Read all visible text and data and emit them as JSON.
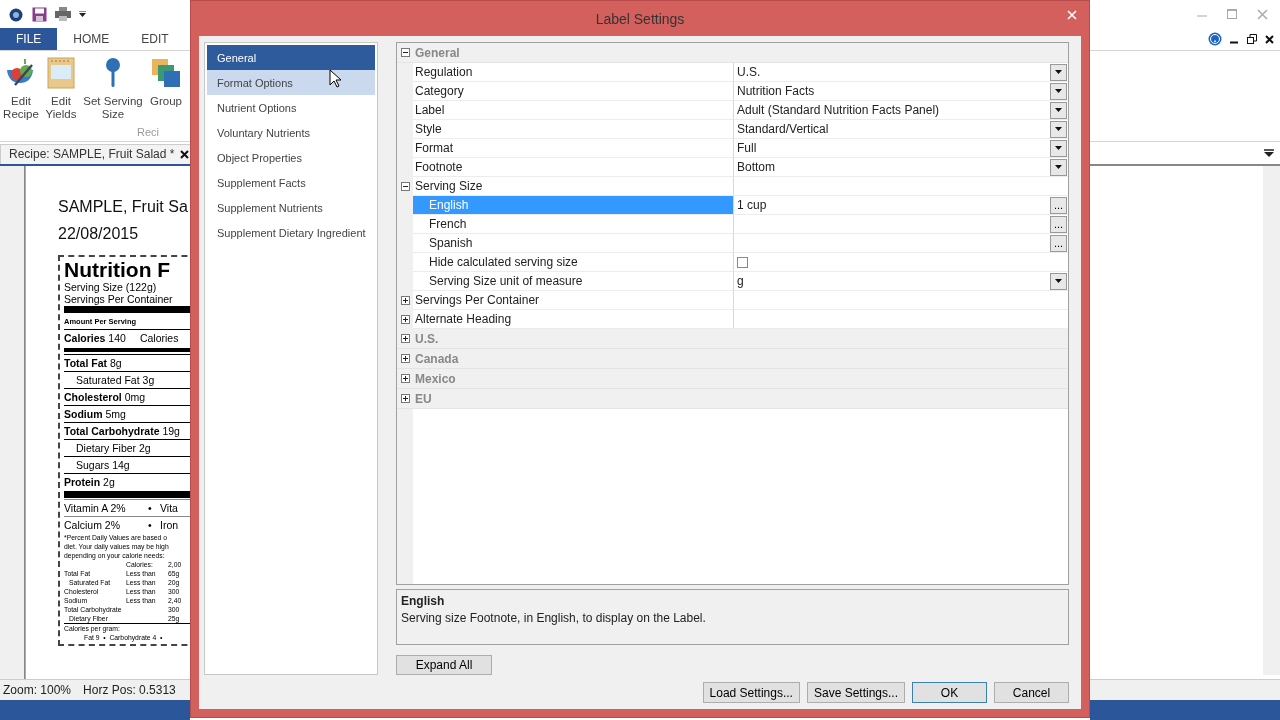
{
  "app": {
    "ribbon_tabs": [
      {
        "label": "FILE",
        "selected": true
      },
      {
        "label": "HOME",
        "selected": false
      },
      {
        "label": "EDIT",
        "selected": false
      }
    ],
    "ribbon_buttons": [
      {
        "label": "Edit Recipe",
        "kind": "bowl"
      },
      {
        "label": "Edit Yields",
        "kind": "oven"
      },
      {
        "label": "Set Serving Size",
        "kind": "spoon"
      },
      {
        "label": "Group",
        "kind": "squares"
      }
    ],
    "ribbon_group_label": "Reci",
    "document_tab": {
      "title": "Recipe: SAMPLE, Fruit Salad *"
    },
    "document": {
      "title": "SAMPLE, Fruit Sa",
      "date": "22/08/2015",
      "nutrition_label": [
        {
          "kind": "title",
          "text": "Nutrition F"
        },
        {
          "kind": "text",
          "text": "Serving Size (122g)"
        },
        {
          "kind": "text",
          "text": "Servings Per Container"
        },
        {
          "kind": "thick_bar"
        },
        {
          "kind": "amount",
          "text": "Amount Per Serving"
        },
        {
          "kind": "row",
          "text": "**Calories** 140",
          "right": "Calories"
        },
        {
          "kind": "medium_bar"
        },
        {
          "kind": "row",
          "text": "**Total Fat** 8g"
        },
        {
          "kind": "indent",
          "text": "Saturated Fat 3g"
        },
        {
          "kind": "row",
          "text": "**Cholesterol** 0mg"
        },
        {
          "kind": "row",
          "text": "**Sodium** 5mg"
        },
        {
          "kind": "row",
          "text": "**Total Carbohydrate** 19g"
        },
        {
          "kind": "indent",
          "text": "Dietary Fiber 2g"
        },
        {
          "kind": "indent",
          "text": "Sugars 14g"
        },
        {
          "kind": "row",
          "text": "**Protein** 2g"
        },
        {
          "kind": "thick_bar"
        },
        {
          "kind": "vitamin",
          "left": "Vitamin A 2%",
          "sep": "•",
          "right": "Vita"
        },
        {
          "kind": "vitamin",
          "left": "Calcium 2%",
          "sep": "•",
          "right": "Iron"
        },
        {
          "kind": "note",
          "text": "*Percent Daily Values are based o"
        },
        {
          "kind": "note",
          "text": "diet. Your daily values may be high"
        },
        {
          "kind": "note",
          "text": "depending on your calorie needs:"
        },
        {
          "kind": "dv_head",
          "limit": "Calories:",
          "amount": "2,00"
        },
        {
          "kind": "dv_row",
          "name": "Total Fat",
          "limit": "Less than",
          "amount": "65g"
        },
        {
          "kind": "dv_sub",
          "name": "Saturated Fat",
          "limit": "Less than",
          "amount": "20g"
        },
        {
          "kind": "dv_row",
          "name": "Cholesterol",
          "limit": "Less than",
          "amount": "300"
        },
        {
          "kind": "dv_row",
          "name": "Sodium",
          "limit": "Less than",
          "amount": "2,40"
        },
        {
          "kind": "dv_row",
          "name": "Total Carbohydrate",
          "amount": "300"
        },
        {
          "kind": "dv_sub",
          "name": "Dietary Fiber",
          "amount": "25g"
        },
        {
          "kind": "note_rule",
          "text": "Calories per gram:"
        },
        {
          "kind": "note_center",
          "text": "Fat 9  •  Carbohydrate 4  •"
        }
      ]
    },
    "status_bar": [
      "Zoom: 100%",
      "Horz Pos: 0.5313"
    ]
  },
  "dialog": {
    "title": "Label Settings",
    "nav": [
      {
        "label": "General",
        "selected": true,
        "hovered": false
      },
      {
        "label": "Format Options",
        "selected": false,
        "hovered": true
      },
      {
        "label": "Nutrient Options",
        "selected": false,
        "hovered": false
      },
      {
        "label": "Voluntary Nutrients",
        "selected": false,
        "hovered": false
      },
      {
        "label": "Object Properties",
        "selected": false,
        "hovered": false
      },
      {
        "label": "Supplement Facts",
        "selected": false,
        "hovered": false
      },
      {
        "label": "Supplement Nutrients",
        "selected": false,
        "hovered": false
      },
      {
        "label": "Supplement Dietary Ingredient",
        "selected": false,
        "hovered": false
      }
    ],
    "property_grid": {
      "categories": [
        {
          "label": "General",
          "expanded": true,
          "properties": [
            {
              "label": "Regulation",
              "value": "U.S.",
              "kind": "dropdown",
              "selected": false
            },
            {
              "label": "Category",
              "value": "Nutrition Facts",
              "kind": "dropdown",
              "selected": false
            },
            {
              "label": "Label",
              "value": "Adult (Standard Nutrition Facts Panel)",
              "kind": "dropdown",
              "selected": false
            },
            {
              "label": "Style",
              "value": "Standard/Vertical",
              "kind": "dropdown",
              "selected": false
            },
            {
              "label": "Format",
              "value": "Full",
              "kind": "dropdown",
              "selected": false
            },
            {
              "label": "Footnote",
              "value": "Bottom",
              "kind": "dropdown",
              "selected": false
            },
            {
              "label": "Serving Size",
              "kind": "group",
              "expanded": true,
              "selected": false,
              "children": [
                {
                  "label": "English",
                  "value": "1 cup",
                  "kind": "text",
                  "button_label": "...",
                  "selected": true
                },
                {
                  "label": "French",
                  "kind": "text",
                  "button_label": "...",
                  "selected": false
                },
                {
                  "label": "Spanish",
                  "kind": "text",
                  "button_label": "...",
                  "selected": false
                },
                {
                  "label": "Hide calculated serving size",
                  "kind": "checkbox",
                  "checked": false,
                  "selected": false
                },
                {
                  "label": "Serving Size unit of measure",
                  "value": "g",
                  "kind": "dropdown",
                  "selected": false
                }
              ]
            },
            {
              "label": "Servings Per Container",
              "kind": "group",
              "expanded": false,
              "selected": false
            },
            {
              "label": "Alternate Heading",
              "kind": "group",
              "expanded": false,
              "selected": false
            }
          ]
        },
        {
          "label": "U.S.",
          "expanded": false
        },
        {
          "label": "Canada",
          "expanded": false
        },
        {
          "label": "Mexico",
          "expanded": false
        },
        {
          "label": "EU",
          "expanded": false
        }
      ]
    },
    "help": {
      "title": "English",
      "text": "Serving size Footnote, in English, to display on the Label."
    },
    "expand_button": "Expand All",
    "buttons": [
      {
        "label": "Load Settings...",
        "default": false
      },
      {
        "label": "Save Settings...",
        "default": false
      },
      {
        "label": "OK",
        "default": true
      },
      {
        "label": "Cancel",
        "default": false
      }
    ]
  }
}
